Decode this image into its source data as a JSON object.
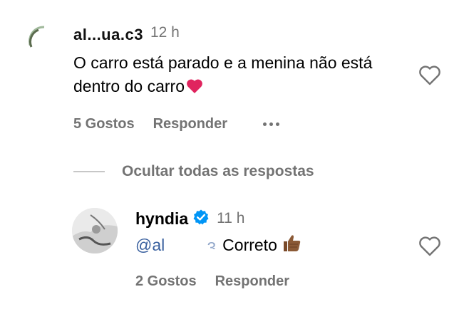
{
  "top_comment": {
    "username": "al...ua.c3",
    "time": "12 h",
    "text": "O carro está parado e a menina não está dentro do carro",
    "likes": "5 Gostos",
    "reply_label": "Responder"
  },
  "hide_replies_label": "Ocultar todas as respostas",
  "reply": {
    "username": "hyndia",
    "time": "11 h",
    "mention_visible": "@al",
    "mention_obscured": "........3",
    "text": "Correto",
    "likes": "2 Gostos",
    "reply_label": "Responder"
  },
  "colors": {
    "secondary_text": "#737373",
    "mention": "#385f9e",
    "verified": "#0095f6",
    "heart": "#e0245e"
  },
  "icons": [
    "heart-emoji",
    "like-heart-icon",
    "more-icon",
    "verified-badge-icon",
    "thumbs-up-emoji"
  ]
}
